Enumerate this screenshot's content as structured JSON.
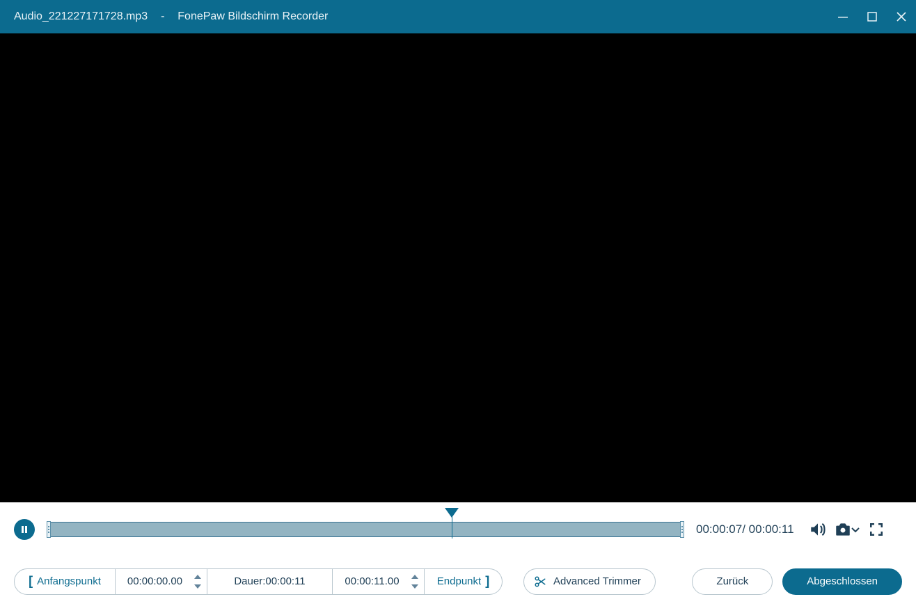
{
  "titlebar": {
    "filename": "Audio_221227171728.mp3",
    "separator": "-",
    "appname": "FonePaw Bildschirm Recorder"
  },
  "playback": {
    "current": "00:00:07",
    "total": "00:00:11"
  },
  "trim": {
    "start_label": "Anfangspunkt",
    "start_value": "00:00:00.00",
    "duration_label": "Dauer:",
    "duration_value": "00:00:11",
    "end_value": "00:00:11.00",
    "end_label": "Endpunkt",
    "advanced_label": "Advanced Trimmer"
  },
  "buttons": {
    "back": "Zurück",
    "done": "Abgeschlossen"
  }
}
